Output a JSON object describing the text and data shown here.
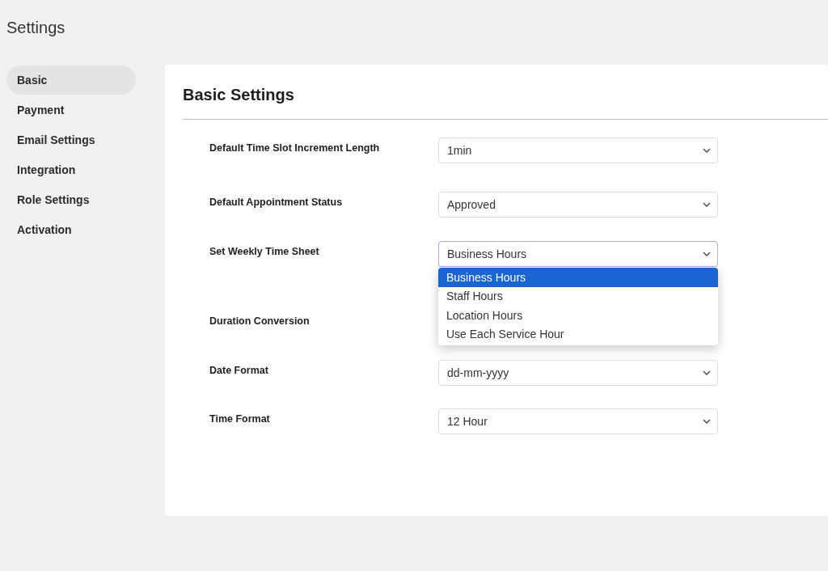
{
  "page": {
    "title": "Settings"
  },
  "sidebar": {
    "items": [
      {
        "label": "Basic",
        "selected": true
      },
      {
        "label": "Payment",
        "selected": false
      },
      {
        "label": "Email Settings",
        "selected": false
      },
      {
        "label": "Integration",
        "selected": false
      },
      {
        "label": "Role Settings",
        "selected": false
      },
      {
        "label": "Activation",
        "selected": false
      }
    ]
  },
  "panel": {
    "title": "Basic Settings",
    "fields": [
      {
        "label": "Default Time Slot Increment Length",
        "value": "1min",
        "open": false
      },
      {
        "label": "Default Appointment Status",
        "value": "Approved",
        "open": false
      },
      {
        "label": "Set Weekly Time Sheet",
        "value": "Business Hours",
        "open": true,
        "options": [
          {
            "label": "Business Hours",
            "selected": true
          },
          {
            "label": "Staff Hours",
            "selected": false
          },
          {
            "label": "Location Hours",
            "selected": false
          },
          {
            "label": "Use Each Service Hour",
            "selected": false
          }
        ]
      },
      {
        "label": "Duration Conversion"
      },
      {
        "label": "Date Format",
        "value": "dd-mm-yyyy",
        "open": false
      },
      {
        "label": "Time Format",
        "value": "12 Hour",
        "open": false
      }
    ]
  }
}
